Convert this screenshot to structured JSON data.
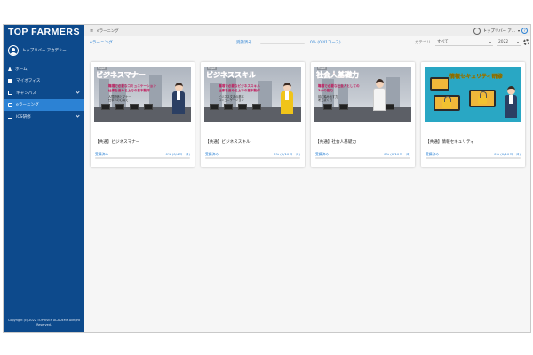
{
  "app": {
    "brand": "TOP FARMERS",
    "user_name": "トップリバー アカデミー",
    "copyright": "Copyright (c) 2022 TOPRIVER ACADEMY Allright Reserved."
  },
  "sidebar": {
    "items": [
      {
        "label": "ホーム",
        "icon": "home-icon",
        "active": false,
        "expandable": false
      },
      {
        "label": "マイオフィス",
        "icon": "office-icon",
        "active": false,
        "expandable": false
      },
      {
        "label": "キャンパス",
        "icon": "campus-icon",
        "active": false,
        "expandable": true
      },
      {
        "label": "eラーニング",
        "icon": "elearning-icon",
        "active": true,
        "expandable": false
      },
      {
        "label": "ICS研修",
        "icon": "ics-icon",
        "active": false,
        "expandable": true
      }
    ]
  },
  "topbar": {
    "breadcrumb": "eラーニング",
    "user": "トップリバー ア...",
    "help": "?"
  },
  "subbar": {
    "title": "eラーニング",
    "status": "受講済み",
    "progress_text": "0% (0/41コース)",
    "progress_value": 0,
    "category_label": "カテゴリ",
    "category_value": "すべて",
    "year_value": "2022"
  },
  "courses": [
    {
      "thumb_brand": "Trajest",
      "thumb_title": "ビジネスマナー",
      "thumb_lines": [
        "職場で必要なコミュニケーション",
        "仕事を進める上での基本動作"
      ],
      "thumb_sub": [
        "人間関係とマナー",
        "仕事への心構え"
      ],
      "title": "【共通】ビジネスマナー",
      "status": "受講済み",
      "progress_text": "0% (0/4コース)",
      "progress_value": 0
    },
    {
      "thumb_brand": "Trajest",
      "thumb_title": "ビジネススキル",
      "thumb_lines": [
        "職場で必要なビジネススキル",
        "仕事を進める上での基本動作"
      ],
      "thumb_sub": [
        "ビジネス文書の基本",
        "コミュニケーション"
      ],
      "title": "【共通】ビジネススキル",
      "status": "受講済み",
      "progress_text": "0% (0/10コース)",
      "progress_value": 0
    },
    {
      "thumb_brand": "Trajest",
      "thumb_title": "社会人基礎力",
      "thumb_lines": [
        "職場で必要な社会人としての",
        "3つの能力"
      ],
      "thumb_sub": [
        "前に踏み出す力",
        "考え抜く力"
      ],
      "title": "【共通】社会人基礎力",
      "status": "受講済み",
      "progress_text": "0% (0/10コース)",
      "progress_value": 0
    },
    {
      "thumb_brand": "",
      "thumb_title": "情報セキュリティ研修",
      "thumb_lines": [],
      "thumb_sub": [],
      "title": "【共通】情報セキュリティ",
      "status": "受講済み",
      "progress_text": "0% (0/10コース)",
      "progress_value": 0
    }
  ],
  "colors": {
    "sidebar": "#0d4a8c",
    "sidebar_active": "#2c82d4",
    "accent": "#2c82d4",
    "thumb_title_pink": "#e94b8b",
    "thumb_title_red": "#d0302c",
    "security_bg": "#29a7c4"
  }
}
